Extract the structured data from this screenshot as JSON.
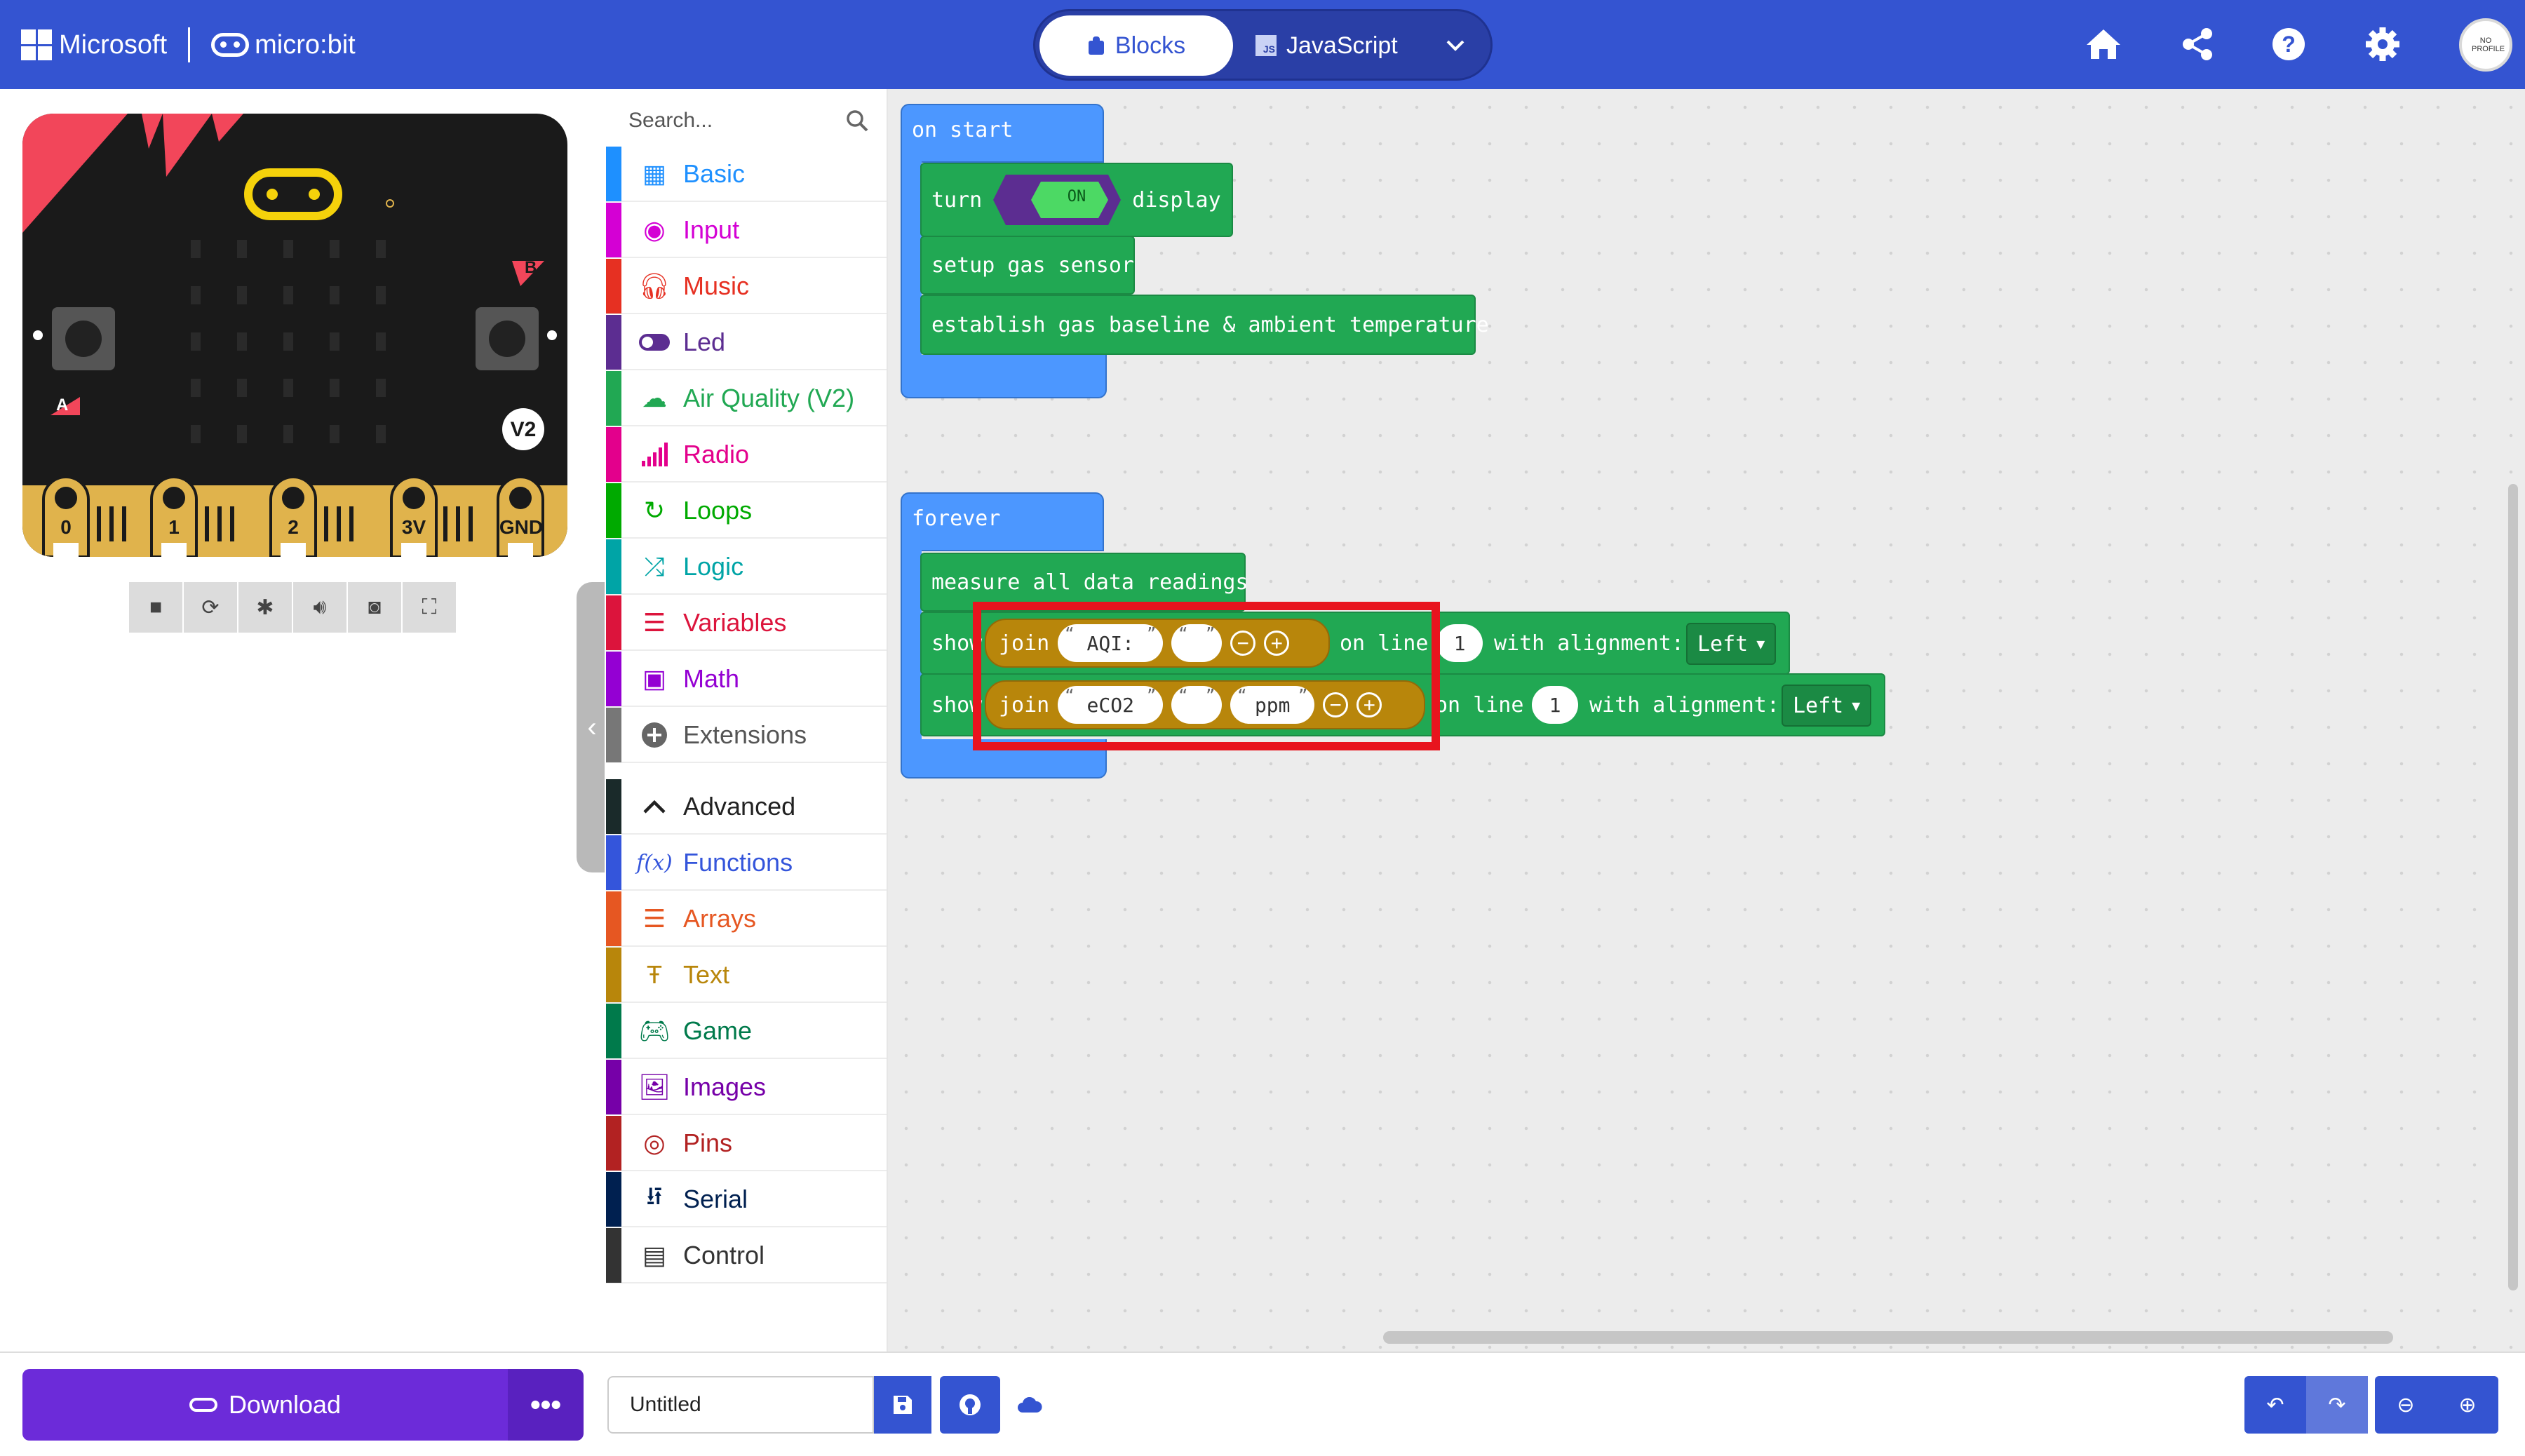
{
  "header": {
    "brand_microsoft": "Microsoft",
    "brand_microbit": "micro:bit",
    "tabs": [
      {
        "label": "Blocks",
        "active": true
      },
      {
        "label": "JavaScript",
        "active": false
      }
    ],
    "icons": [
      "home-icon",
      "share-icon",
      "help-icon",
      "settings-icon",
      "avatar"
    ],
    "avatar_text": "NO PROFILE",
    "color": "#3454d1"
  },
  "simulator": {
    "pins": [
      "0",
      "1",
      "2",
      "3V",
      "GND"
    ],
    "button_a": "A",
    "button_b": "B",
    "version_badge": "V2",
    "toolbar_icons": [
      "stop-icon",
      "restart-icon",
      "debug-icon",
      "sound-icon",
      "screenshot-icon",
      "fullscreen-icon"
    ]
  },
  "toolbox": {
    "search_placeholder": "Search...",
    "categories": [
      {
        "label": "Basic",
        "color": "#1e90ff",
        "icon": "grid-icon"
      },
      {
        "label": "Input",
        "color": "#d400d4",
        "icon": "target-icon"
      },
      {
        "label": "Music",
        "color": "#e63022",
        "icon": "headphones-icon"
      },
      {
        "label": "Led",
        "color": "#5c2d91",
        "icon": "toggle-icon"
      },
      {
        "label": "Air Quality (V2)",
        "color": "#21a853",
        "icon": "cloud-icon"
      },
      {
        "label": "Radio",
        "color": "#e3008c",
        "icon": "signal-icon"
      },
      {
        "label": "Loops",
        "color": "#00aa00",
        "icon": "loop-icon"
      },
      {
        "label": "Logic",
        "color": "#00a4a6",
        "icon": "shuffle-icon"
      },
      {
        "label": "Variables",
        "color": "#dc143c",
        "icon": "lines-icon"
      },
      {
        "label": "Math",
        "color": "#9400d3",
        "icon": "calculator-icon"
      },
      {
        "label": "Extensions",
        "color": "#777777",
        "icon": "plus-icon"
      }
    ],
    "advanced_label": "Advanced",
    "advanced": [
      {
        "label": "Functions",
        "color": "#3455db",
        "icon": "function-icon"
      },
      {
        "label": "Arrays",
        "color": "#e65722",
        "icon": "list-icon"
      },
      {
        "label": "Text",
        "color": "#b8860b",
        "icon": "text-icon"
      },
      {
        "label": "Game",
        "color": "#007a4b",
        "icon": "gamepad-icon"
      },
      {
        "label": "Images",
        "color": "#7600a8",
        "icon": "image-icon"
      },
      {
        "label": "Pins",
        "color": "#b22222",
        "icon": "pin-icon"
      },
      {
        "label": "Serial",
        "color": "#002050",
        "icon": "usb-icon"
      },
      {
        "label": "Control",
        "color": "#333333",
        "icon": "server-icon"
      }
    ]
  },
  "workspace": {
    "on_start": {
      "hat": "on start",
      "turn_label": "turn",
      "toggle": "ON",
      "display_label": "display",
      "setup": "setup gas sensor",
      "establish": "establish gas baseline & ambient temperature"
    },
    "forever": {
      "hat": "forever",
      "measure": "measure all data readings",
      "show_label": "show",
      "join_label": "join",
      "row1": {
        "str1": "AQI:",
        "str2": "",
        "line_label": "on line",
        "line": "1",
        "align_label": "with alignment:",
        "align": "Left"
      },
      "row2": {
        "str1": "eCO2",
        "str2": "",
        "str3": "ppm",
        "line_label": "on line",
        "line": "1",
        "align_label": "with alignment:",
        "align": "Left"
      }
    }
  },
  "footer": {
    "download_label": "Download",
    "more_label": "•••",
    "project_name": "Untitled",
    "icons": [
      "save-icon",
      "github-icon",
      "cloud-icon",
      "undo-icon",
      "redo-icon",
      "zoom-out-icon",
      "zoom-in-icon"
    ]
  }
}
